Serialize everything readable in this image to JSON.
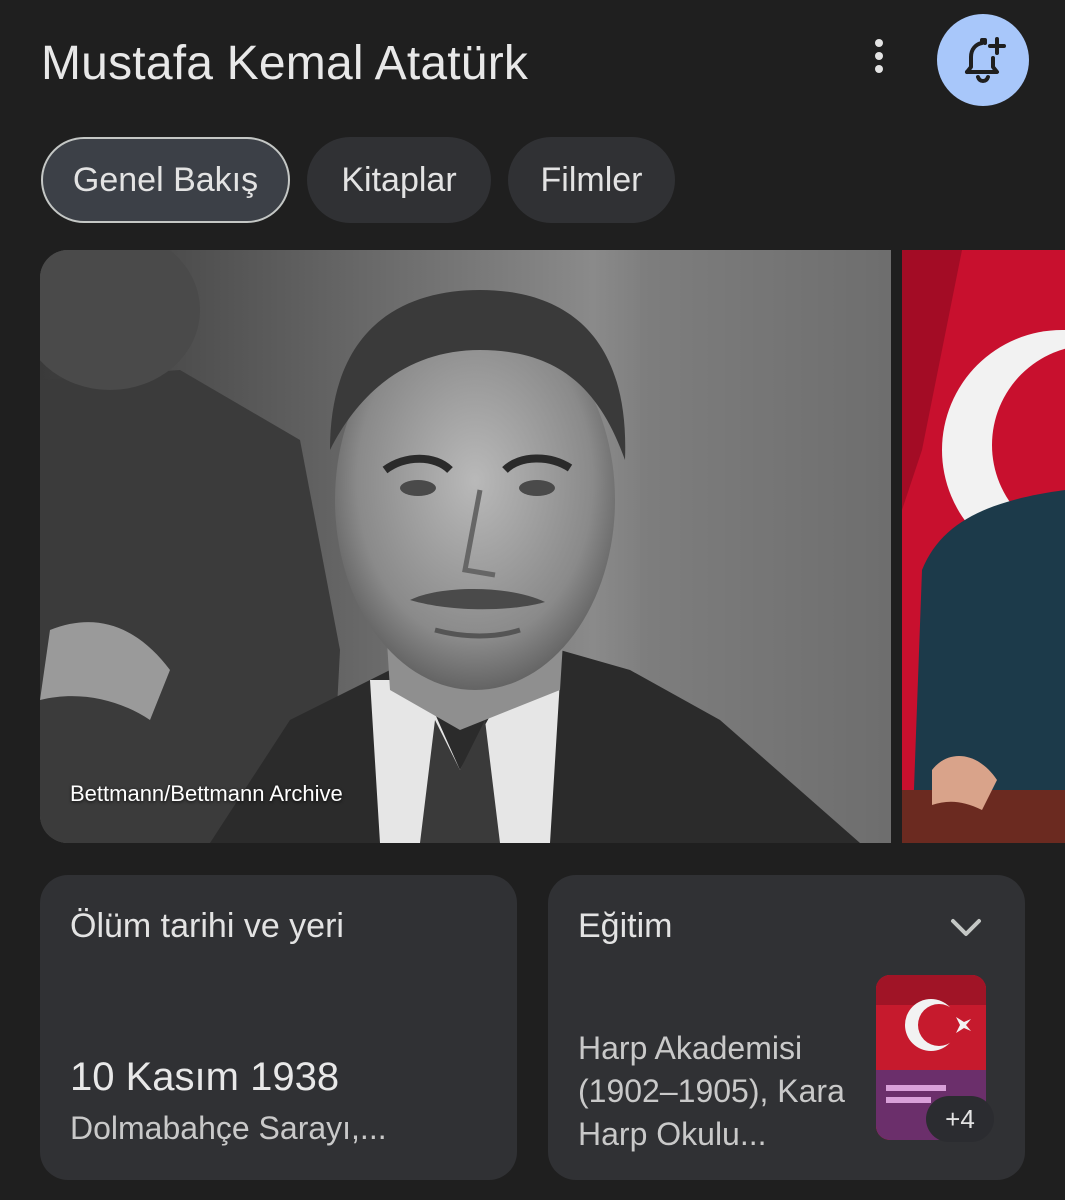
{
  "header": {
    "title": "Mustafa Kemal Atatürk",
    "more_icon": "more-vert-icon",
    "bell_icon": "bell-add-icon"
  },
  "tabs": [
    {
      "label": "Genel Bakış",
      "active": true
    },
    {
      "label": "Kitaplar",
      "active": false
    },
    {
      "label": "Filmler",
      "active": false
    }
  ],
  "images": {
    "main_credit": "Bettmann/Bettmann Archive"
  },
  "cards": {
    "death": {
      "title": "Ölüm tarihi ve yeri",
      "date": "10 Kasım 1938",
      "place": "Dolmabahçe Sarayı,..."
    },
    "education": {
      "title": "Eğitim",
      "text": "Harp Akademisi (1902–1905), Kara Harp Okulu...",
      "more_count": "+4",
      "chevron_icon": "chevron-down-icon"
    }
  },
  "colors": {
    "background": "#1f1f1f",
    "card": "#303134",
    "bell_button": "#a8c7fa",
    "flag_red": "#c8102e"
  }
}
